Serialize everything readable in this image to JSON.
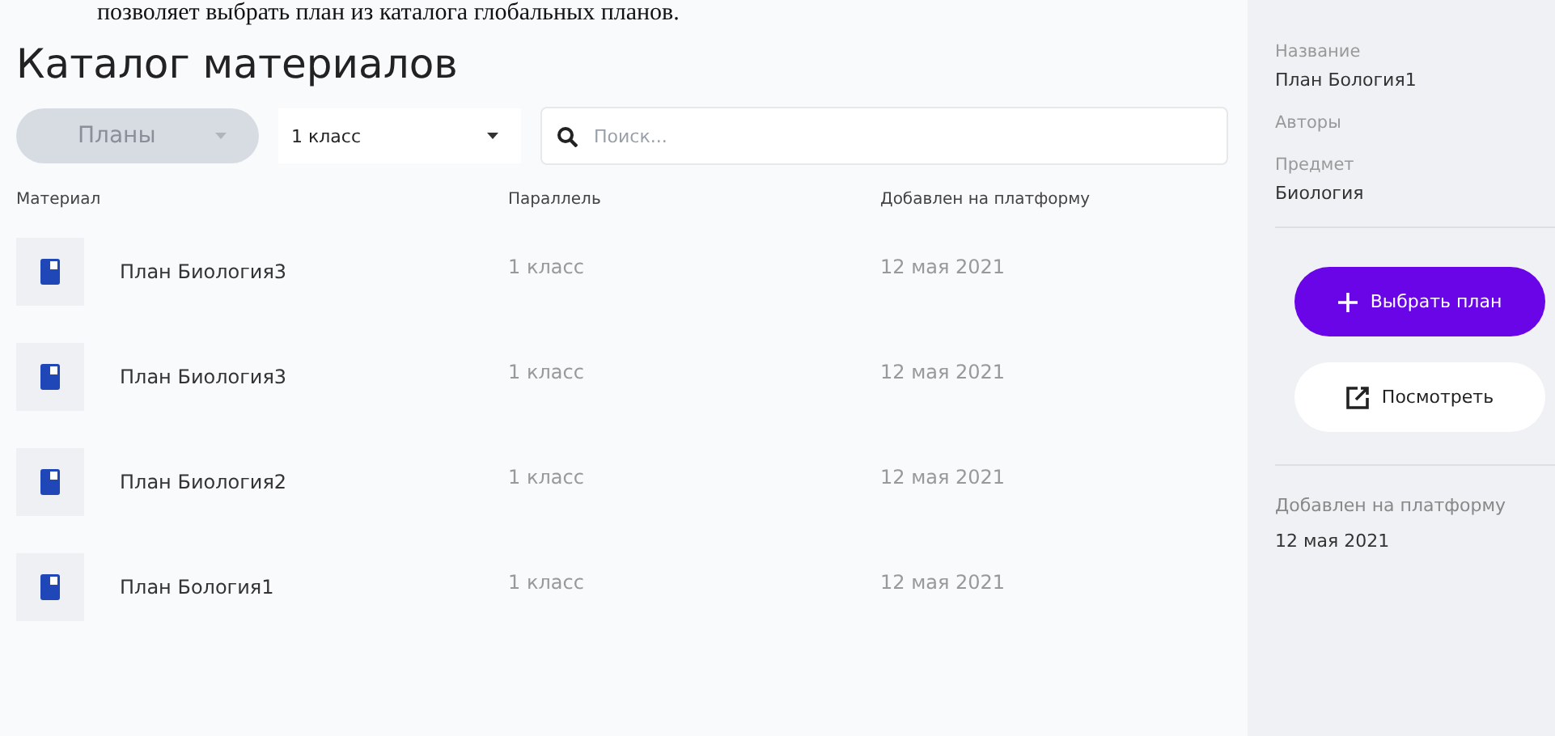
{
  "caption": "позволяет выбрать план из каталога глобальных планов.",
  "title": "Каталог материалов",
  "filters": [
    {
      "kind": "pill",
      "label": "Планы",
      "disabled": true
    },
    {
      "kind": "select",
      "label": "1 класс",
      "disabled": false
    }
  ],
  "search": {
    "placeholder": "Поиск..."
  },
  "table": {
    "columns": [
      "Материал",
      "Параллель",
      "Добавлен на платформу"
    ],
    "rows": [
      {
        "name": "План Биология3",
        "grade": "1 класс",
        "date": "12 мая 2021"
      },
      {
        "name": "План Биология3",
        "grade": "1 класс",
        "date": "12 мая 2021"
      },
      {
        "name": "План Биология2",
        "grade": "1 класс",
        "date": "12 мая 2021"
      },
      {
        "name": "План Бология1",
        "grade": "1 класс",
        "date": "12 мая 2021"
      }
    ]
  },
  "details": {
    "fields": [
      {
        "label": "Название",
        "value": "План Бология1"
      },
      {
        "label": "Авторы"
      },
      {
        "label": "Предмет",
        "value": "Биология"
      }
    ],
    "buttons": [
      {
        "kind": "primary",
        "label": "Выбрать план"
      },
      {
        "kind": "secondary",
        "label": "Посмотреть"
      }
    ],
    "added": {
      "label": "Добавлен на платформу",
      "value": "12 мая 2021"
    }
  }
}
